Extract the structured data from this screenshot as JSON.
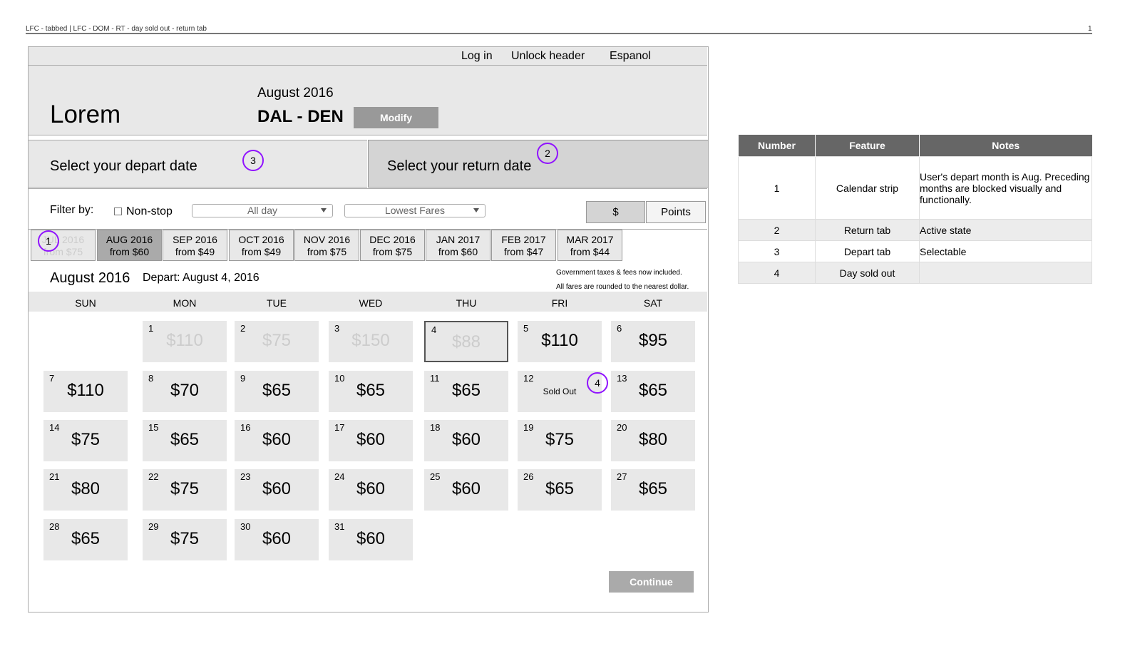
{
  "page": {
    "header_text": "LFC - tabbed | LFC - DOM - RT - day sold out - return tab",
    "page_number": "1"
  },
  "topbar": {
    "login": "Log in",
    "unlock": "Unlock header",
    "espanol": "Espanol"
  },
  "header": {
    "logo": "Lorem",
    "month": "August 2016",
    "route": "DAL - DEN",
    "modify_label": "Modify"
  },
  "tabs": {
    "depart_label": "Select your depart date",
    "return_label": "Select your return date"
  },
  "markers": {
    "one": "1",
    "two": "2",
    "three": "3",
    "four": "4"
  },
  "filter": {
    "label": "Filter by:",
    "nonstop": "Non-stop",
    "time_value": "All day",
    "sort_value": "Lowest Fares",
    "currency": "$",
    "points": "Points"
  },
  "months": [
    {
      "name": "JUL 2016",
      "fare": "from $75"
    },
    {
      "name": "AUG 2016",
      "fare": "from $60"
    },
    {
      "name": "SEP 2016",
      "fare": "from $49"
    },
    {
      "name": "OCT 2016",
      "fare": "from $49"
    },
    {
      "name": "NOV 2016",
      "fare": "from $75"
    },
    {
      "name": "DEC 2016",
      "fare": "from $75"
    },
    {
      "name": "JAN 2017",
      "fare": "from $60"
    },
    {
      "name": "FEB 2017",
      "fare": "from $47"
    },
    {
      "name": "MAR 2017",
      "fare": "from $44"
    }
  ],
  "calendar": {
    "month": "August 2016",
    "depart": "Depart: August 4, 2016",
    "note1": "Government taxes & fees now included.",
    "note2": "All fares are rounded to the nearest dollar.",
    "weekdays": [
      "SUN",
      "MON",
      "TUE",
      "WED",
      "THU",
      "FRI",
      "SAT"
    ],
    "days": [
      {
        "d": "1",
        "p": "$110"
      },
      {
        "d": "2",
        "p": "$75"
      },
      {
        "d": "3",
        "p": "$150"
      },
      {
        "d": "4",
        "p": "$88"
      },
      {
        "d": "5",
        "p": "$110"
      },
      {
        "d": "6",
        "p": "$95"
      },
      {
        "d": "7",
        "p": "$110"
      },
      {
        "d": "8",
        "p": "$70"
      },
      {
        "d": "9",
        "p": "$65"
      },
      {
        "d": "10",
        "p": "$65"
      },
      {
        "d": "11",
        "p": "$65"
      },
      {
        "d": "12",
        "p": "Sold Out"
      },
      {
        "d": "13",
        "p": "$65"
      },
      {
        "d": "14",
        "p": "$75"
      },
      {
        "d": "15",
        "p": "$65"
      },
      {
        "d": "16",
        "p": "$60"
      },
      {
        "d": "17",
        "p": "$60"
      },
      {
        "d": "18",
        "p": "$60"
      },
      {
        "d": "19",
        "p": "$75"
      },
      {
        "d": "20",
        "p": "$80"
      },
      {
        "d": "21",
        "p": "$80"
      },
      {
        "d": "22",
        "p": "$75"
      },
      {
        "d": "23",
        "p": "$60"
      },
      {
        "d": "24",
        "p": "$60"
      },
      {
        "d": "25",
        "p": "$60"
      },
      {
        "d": "26",
        "p": "$65"
      },
      {
        "d": "27",
        "p": "$65"
      },
      {
        "d": "28",
        "p": "$65"
      },
      {
        "d": "29",
        "p": "$75"
      },
      {
        "d": "30",
        "p": "$60"
      },
      {
        "d": "31",
        "p": "$60"
      }
    ],
    "continue_label": "Continue"
  },
  "notes_table": {
    "headers": [
      "Number",
      "Feature",
      "Notes"
    ],
    "rows": [
      {
        "num": "1",
        "feature": "Calendar strip",
        "notes": "User's depart month is Aug. Preceding months are blocked visually and functionally."
      },
      {
        "num": "2",
        "feature": "Return tab",
        "notes": "Active state"
      },
      {
        "num": "3",
        "feature": "Depart tab",
        "notes": "Selectable"
      },
      {
        "num": "4",
        "feature": "Day sold out",
        "notes": ""
      }
    ]
  },
  "colors": {
    "marker": "#9013fe",
    "panel": "#e8e8e8",
    "button": "#999999"
  }
}
